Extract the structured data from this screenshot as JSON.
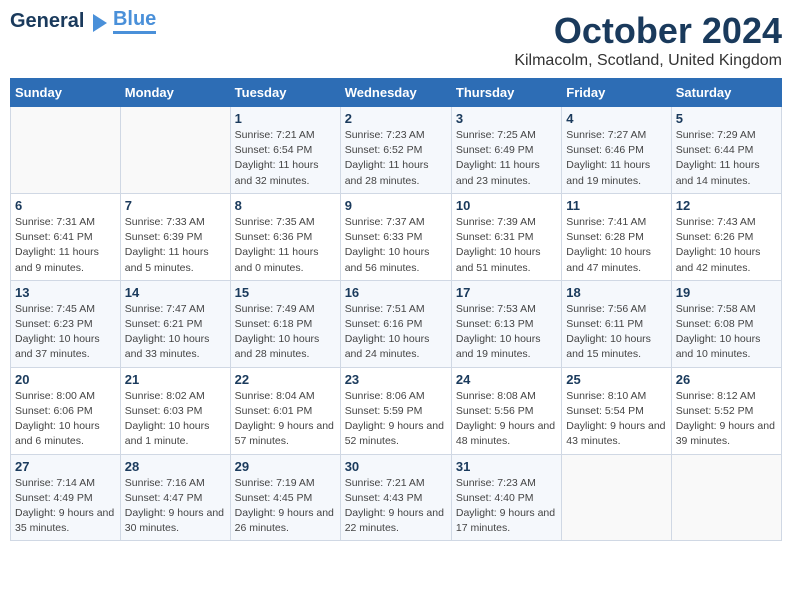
{
  "logo": {
    "part1": "General",
    "part2": "Blue"
  },
  "title": "October 2024",
  "location": "Kilmacolm, Scotland, United Kingdom",
  "days_of_week": [
    "Sunday",
    "Monday",
    "Tuesday",
    "Wednesday",
    "Thursday",
    "Friday",
    "Saturday"
  ],
  "weeks": [
    [
      {
        "day": "",
        "sunrise": "",
        "sunset": "",
        "daylight": ""
      },
      {
        "day": "",
        "sunrise": "",
        "sunset": "",
        "daylight": ""
      },
      {
        "day": "1",
        "sunrise": "Sunrise: 7:21 AM",
        "sunset": "Sunset: 6:54 PM",
        "daylight": "Daylight: 11 hours and 32 minutes."
      },
      {
        "day": "2",
        "sunrise": "Sunrise: 7:23 AM",
        "sunset": "Sunset: 6:52 PM",
        "daylight": "Daylight: 11 hours and 28 minutes."
      },
      {
        "day": "3",
        "sunrise": "Sunrise: 7:25 AM",
        "sunset": "Sunset: 6:49 PM",
        "daylight": "Daylight: 11 hours and 23 minutes."
      },
      {
        "day": "4",
        "sunrise": "Sunrise: 7:27 AM",
        "sunset": "Sunset: 6:46 PM",
        "daylight": "Daylight: 11 hours and 19 minutes."
      },
      {
        "day": "5",
        "sunrise": "Sunrise: 7:29 AM",
        "sunset": "Sunset: 6:44 PM",
        "daylight": "Daylight: 11 hours and 14 minutes."
      }
    ],
    [
      {
        "day": "6",
        "sunrise": "Sunrise: 7:31 AM",
        "sunset": "Sunset: 6:41 PM",
        "daylight": "Daylight: 11 hours and 9 minutes."
      },
      {
        "day": "7",
        "sunrise": "Sunrise: 7:33 AM",
        "sunset": "Sunset: 6:39 PM",
        "daylight": "Daylight: 11 hours and 5 minutes."
      },
      {
        "day": "8",
        "sunrise": "Sunrise: 7:35 AM",
        "sunset": "Sunset: 6:36 PM",
        "daylight": "Daylight: 11 hours and 0 minutes."
      },
      {
        "day": "9",
        "sunrise": "Sunrise: 7:37 AM",
        "sunset": "Sunset: 6:33 PM",
        "daylight": "Daylight: 10 hours and 56 minutes."
      },
      {
        "day": "10",
        "sunrise": "Sunrise: 7:39 AM",
        "sunset": "Sunset: 6:31 PM",
        "daylight": "Daylight: 10 hours and 51 minutes."
      },
      {
        "day": "11",
        "sunrise": "Sunrise: 7:41 AM",
        "sunset": "Sunset: 6:28 PM",
        "daylight": "Daylight: 10 hours and 47 minutes."
      },
      {
        "day": "12",
        "sunrise": "Sunrise: 7:43 AM",
        "sunset": "Sunset: 6:26 PM",
        "daylight": "Daylight: 10 hours and 42 minutes."
      }
    ],
    [
      {
        "day": "13",
        "sunrise": "Sunrise: 7:45 AM",
        "sunset": "Sunset: 6:23 PM",
        "daylight": "Daylight: 10 hours and 37 minutes."
      },
      {
        "day": "14",
        "sunrise": "Sunrise: 7:47 AM",
        "sunset": "Sunset: 6:21 PM",
        "daylight": "Daylight: 10 hours and 33 minutes."
      },
      {
        "day": "15",
        "sunrise": "Sunrise: 7:49 AM",
        "sunset": "Sunset: 6:18 PM",
        "daylight": "Daylight: 10 hours and 28 minutes."
      },
      {
        "day": "16",
        "sunrise": "Sunrise: 7:51 AM",
        "sunset": "Sunset: 6:16 PM",
        "daylight": "Daylight: 10 hours and 24 minutes."
      },
      {
        "day": "17",
        "sunrise": "Sunrise: 7:53 AM",
        "sunset": "Sunset: 6:13 PM",
        "daylight": "Daylight: 10 hours and 19 minutes."
      },
      {
        "day": "18",
        "sunrise": "Sunrise: 7:56 AM",
        "sunset": "Sunset: 6:11 PM",
        "daylight": "Daylight: 10 hours and 15 minutes."
      },
      {
        "day": "19",
        "sunrise": "Sunrise: 7:58 AM",
        "sunset": "Sunset: 6:08 PM",
        "daylight": "Daylight: 10 hours and 10 minutes."
      }
    ],
    [
      {
        "day": "20",
        "sunrise": "Sunrise: 8:00 AM",
        "sunset": "Sunset: 6:06 PM",
        "daylight": "Daylight: 10 hours and 6 minutes."
      },
      {
        "day": "21",
        "sunrise": "Sunrise: 8:02 AM",
        "sunset": "Sunset: 6:03 PM",
        "daylight": "Daylight: 10 hours and 1 minute."
      },
      {
        "day": "22",
        "sunrise": "Sunrise: 8:04 AM",
        "sunset": "Sunset: 6:01 PM",
        "daylight": "Daylight: 9 hours and 57 minutes."
      },
      {
        "day": "23",
        "sunrise": "Sunrise: 8:06 AM",
        "sunset": "Sunset: 5:59 PM",
        "daylight": "Daylight: 9 hours and 52 minutes."
      },
      {
        "day": "24",
        "sunrise": "Sunrise: 8:08 AM",
        "sunset": "Sunset: 5:56 PM",
        "daylight": "Daylight: 9 hours and 48 minutes."
      },
      {
        "day": "25",
        "sunrise": "Sunrise: 8:10 AM",
        "sunset": "Sunset: 5:54 PM",
        "daylight": "Daylight: 9 hours and 43 minutes."
      },
      {
        "day": "26",
        "sunrise": "Sunrise: 8:12 AM",
        "sunset": "Sunset: 5:52 PM",
        "daylight": "Daylight: 9 hours and 39 minutes."
      }
    ],
    [
      {
        "day": "27",
        "sunrise": "Sunrise: 7:14 AM",
        "sunset": "Sunset: 4:49 PM",
        "daylight": "Daylight: 9 hours and 35 minutes."
      },
      {
        "day": "28",
        "sunrise": "Sunrise: 7:16 AM",
        "sunset": "Sunset: 4:47 PM",
        "daylight": "Daylight: 9 hours and 30 minutes."
      },
      {
        "day": "29",
        "sunrise": "Sunrise: 7:19 AM",
        "sunset": "Sunset: 4:45 PM",
        "daylight": "Daylight: 9 hours and 26 minutes."
      },
      {
        "day": "30",
        "sunrise": "Sunrise: 7:21 AM",
        "sunset": "Sunset: 4:43 PM",
        "daylight": "Daylight: 9 hours and 22 minutes."
      },
      {
        "day": "31",
        "sunrise": "Sunrise: 7:23 AM",
        "sunset": "Sunset: 4:40 PM",
        "daylight": "Daylight: 9 hours and 17 minutes."
      },
      {
        "day": "",
        "sunrise": "",
        "sunset": "",
        "daylight": ""
      },
      {
        "day": "",
        "sunrise": "",
        "sunset": "",
        "daylight": ""
      }
    ]
  ]
}
